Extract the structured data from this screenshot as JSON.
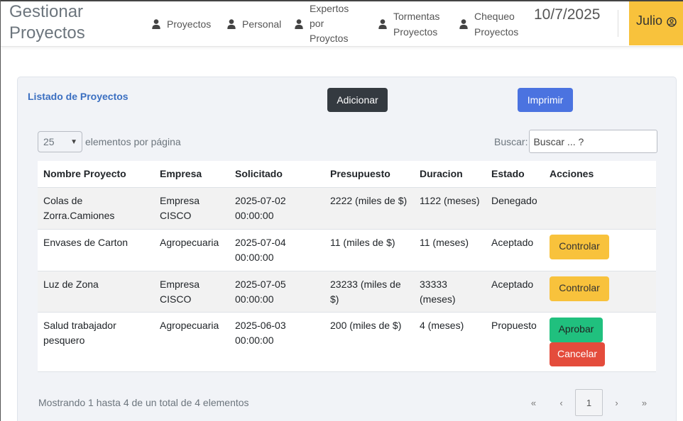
{
  "brand": "Gestionar Proyectos",
  "nav": [
    {
      "label": "Proyectos"
    },
    {
      "label": "Personal"
    },
    {
      "label": "Expertos por Proyctos"
    },
    {
      "label": "Tormentas Proyectos"
    },
    {
      "label": "Chequeo Proyectos"
    }
  ],
  "date": "10/7/2025",
  "user": {
    "name": "Julio"
  },
  "card": {
    "title": "Listado de Proyectos",
    "add_label": "Adicionar",
    "print_label": "Imprimir",
    "per_page_value": "25",
    "per_page_suffix": "elementos por página",
    "search_label": "Buscar:",
    "search_placeholder": "Buscar ... ?"
  },
  "table": {
    "headers": [
      "Nombre Proyecto",
      "Empresa",
      "Solicitado",
      "Presupuesto",
      "Duracion",
      "Estado",
      "Acciones"
    ],
    "rows": [
      {
        "name": "Colas de Zorra.Camiones",
        "empresa": "Empresa CISCO",
        "solicitado": "2025-07-02 00:00:00",
        "presupuesto": "2222 (miles de $)",
        "duracion": "1122 (meses)",
        "estado": "Denegado",
        "actions": []
      },
      {
        "name": "Envases de Carton",
        "empresa": "Agropecuaria",
        "solicitado": "2025-07-04 00:00:00",
        "presupuesto": "11 (miles de $)",
        "duracion": "11 (meses)",
        "estado": "Aceptado",
        "actions": [
          "Controlar"
        ]
      },
      {
        "name": "Luz de Zona",
        "empresa": "Empresa CISCO",
        "solicitado": "2025-07-05 00:00:00",
        "presupuesto": "23233 (miles de $)",
        "duracion": "33333 (meses)",
        "estado": "Aceptado",
        "actions": [
          "Controlar"
        ]
      },
      {
        "name": "Salud trabajador pesquero",
        "empresa": "Agropecuaria",
        "solicitado": "2025-06-03 00:00:00",
        "presupuesto": "200 (miles de $)",
        "duracion": "4 (meses)",
        "estado": "Propuesto",
        "actions": [
          "Aprobar",
          "Cancelar"
        ]
      }
    ]
  },
  "footer": {
    "info": "Mostrando 1 hasta 4 de un total de 4 elementos",
    "pager": {
      "first": "«",
      "prev": "‹",
      "current": "1",
      "next": "›",
      "last": "»"
    }
  },
  "icons": {
    "nav": "user-icon",
    "user": "user-circle-icon",
    "select": "chevron-down-icon"
  },
  "colors": {
    "accent_yellow": "#f8c23c",
    "print_blue": "#4b73e0",
    "approve_green": "#20c07e",
    "cancel_red": "#e44c3c",
    "title_blue": "#3b6fc1"
  }
}
